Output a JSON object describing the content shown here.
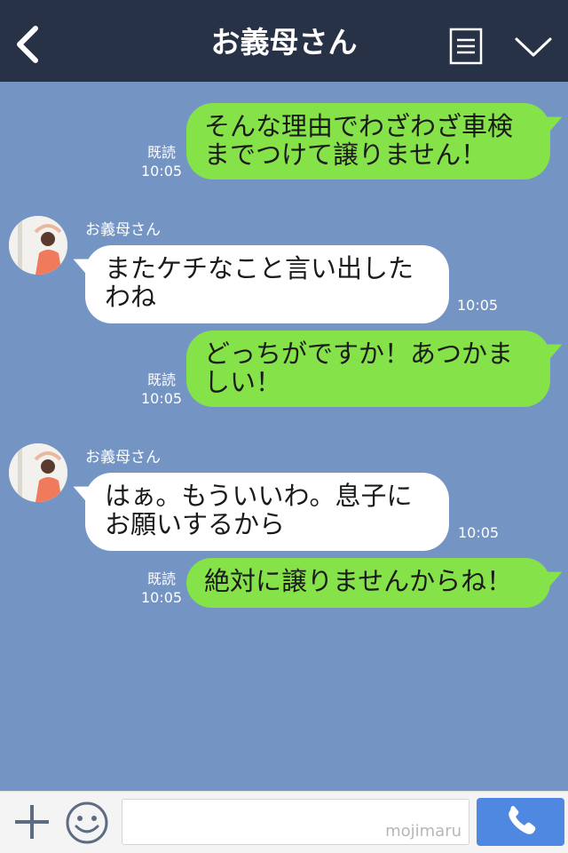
{
  "header": {
    "title": "お義母さん"
  },
  "messages": [
    {
      "side": "out",
      "text_lines": [
        "そんな理由でわざわざ車検",
        "までつけて譲りません！"
      ],
      "read": "既読",
      "time": "10:05"
    },
    {
      "side": "in",
      "sender": "お義母さん",
      "text_lines": [
        "またケチなこと言い出した",
        "わね"
      ],
      "time": "10:05"
    },
    {
      "side": "out",
      "text_lines": [
        "どっちがですか！あつかま",
        "しい！"
      ],
      "read": "既読",
      "time": "10:05"
    },
    {
      "side": "in",
      "sender": "お義母さん",
      "text_lines": [
        "はぁ。もういいわ。息子に",
        "お願いするから"
      ],
      "time": "10:05"
    },
    {
      "side": "out",
      "text_lines": [
        "絶対に譲りませんからね！"
      ],
      "read": "既読",
      "time": "10:05"
    }
  ],
  "input_bar": {
    "watermark": "mojimaru"
  },
  "colors": {
    "header_bg": "#273246",
    "chat_bg": "#7494c3",
    "outgoing_bubble": "#85e249",
    "incoming_bubble": "#ffffff",
    "call_button": "#4f88e0"
  },
  "icons": [
    "back-arrow-icon",
    "menu-icon",
    "chevron-down-icon",
    "plus-icon",
    "emoji-icon",
    "phone-icon"
  ]
}
